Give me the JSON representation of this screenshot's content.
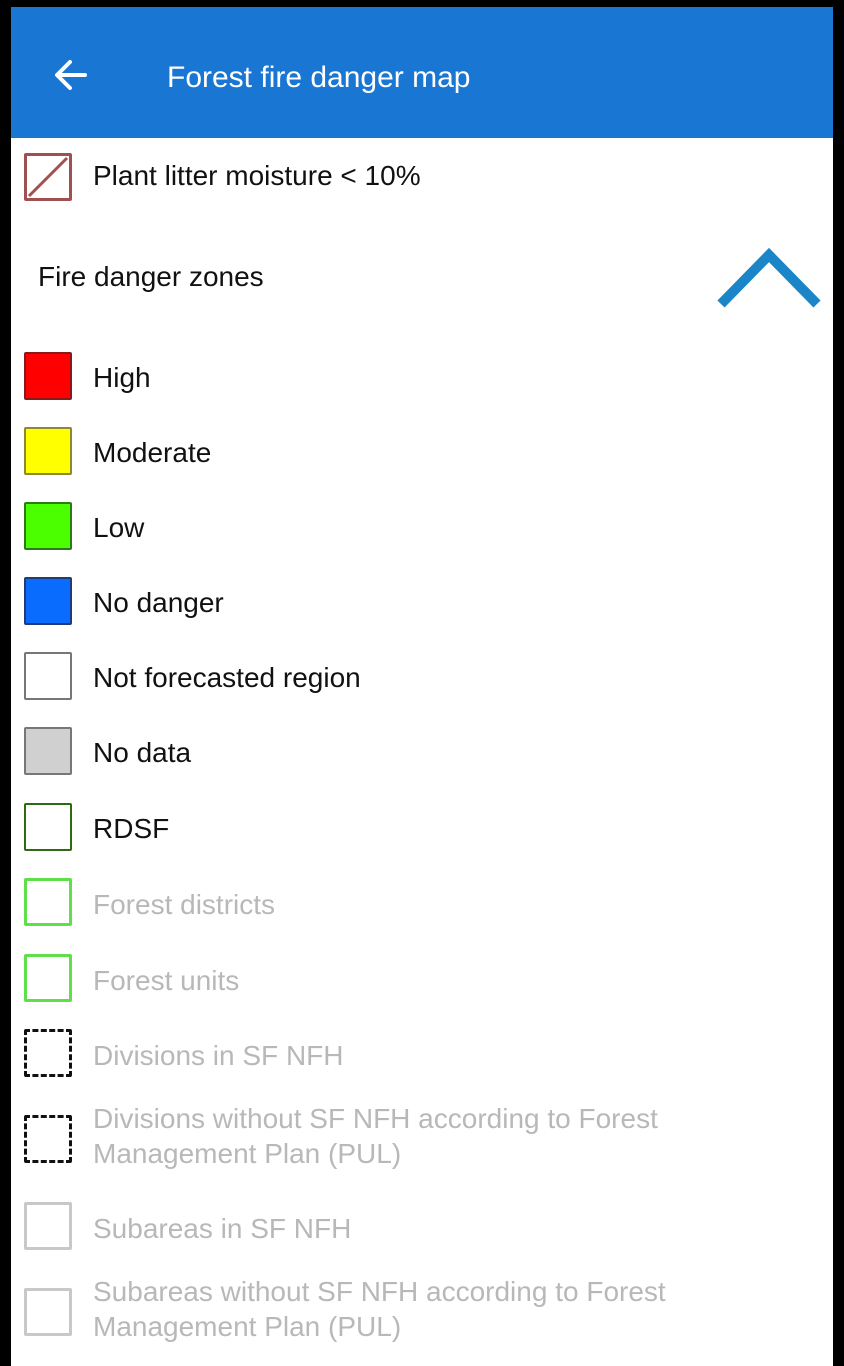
{
  "header": {
    "title": "Forest fire danger map",
    "back_icon": "arrow-left-icon",
    "background": "#1976d2"
  },
  "plant_litter": {
    "label": "Plant litter moisture < 10%",
    "icon": "hatched-square-icon",
    "border_color": "#a05050"
  },
  "zones": {
    "title": "Fire danger zones",
    "collapse_icon": "chevron-up-icon",
    "collapse_color": "#1a86c8",
    "items": [
      {
        "label": "High",
        "fill": "#ff0000",
        "border": "#8a1a1a"
      },
      {
        "label": "Moderate",
        "fill": "#ffff00",
        "border": "#8a8a30"
      },
      {
        "label": "Low",
        "fill": "#4cff00",
        "border": "#2e7a18"
      },
      {
        "label": "No danger",
        "fill": "#0a6cff",
        "border": "#1e3c78"
      },
      {
        "label": "Not forecasted region",
        "fill": "#ffffff",
        "border": "#777777"
      },
      {
        "label": "No data",
        "fill": "#d0d0d0",
        "border": "#777777"
      },
      {
        "label": "RDSF",
        "fill": "#ffffff",
        "border": "#2e6b10"
      }
    ]
  },
  "layers": [
    {
      "label": "Forest districts",
      "border": "#5fe04a",
      "style": "solid"
    },
    {
      "label": "Forest units",
      "border": "#5fe04a",
      "style": "solid"
    },
    {
      "label": "Divisions in SF NFH",
      "border": "#111111",
      "style": "dashed"
    },
    {
      "label": "Divisions without SF NFH according to Forest Management Plan (PUL)",
      "border": "#111111",
      "style": "dashed"
    },
    {
      "label": "Subareas in SF NFH",
      "border": "#c8c8c8",
      "style": "solid"
    },
    {
      "label": "Subareas without SF NFH according to Forest Management Plan (PUL)",
      "border": "#c8c8c8",
      "style": "solid"
    }
  ]
}
